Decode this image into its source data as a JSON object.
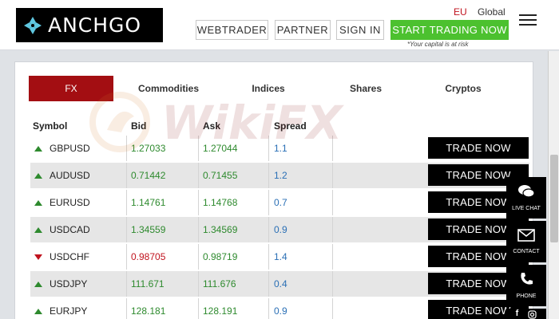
{
  "header": {
    "logo_text": "ANCHGO",
    "nav": [
      "WEBTRADER",
      "PARTNER",
      "SIGN IN"
    ],
    "cta": "START TRADING NOW",
    "disclaimer": "*Your capital is at risk",
    "region": "EU",
    "language": "Global"
  },
  "tabs": [
    "FX",
    "Commodities",
    "Indices",
    "Shares",
    "Cryptos"
  ],
  "active_tab": "FX",
  "columns": {
    "symbol": "Symbol",
    "bid": "Bid",
    "ask": "Ask",
    "spread": "Spread"
  },
  "trade_label": "TRADE NOW",
  "rows": [
    {
      "symbol": "GBPUSD",
      "bid": "1.27033",
      "ask": "1.27044",
      "spread": "1.1",
      "direction": "up"
    },
    {
      "symbol": "AUDUSD",
      "bid": "0.71442",
      "ask": "0.71455",
      "spread": "1.2",
      "direction": "up"
    },
    {
      "symbol": "EURUSD",
      "bid": "1.14761",
      "ask": "1.14768",
      "spread": "0.7",
      "direction": "up"
    },
    {
      "symbol": "USDCAD",
      "bid": "1.34559",
      "ask": "1.34569",
      "spread": "0.9",
      "direction": "up"
    },
    {
      "symbol": "USDCHF",
      "bid": "0.98705",
      "ask": "0.98719",
      "spread": "1.4",
      "direction": "down"
    },
    {
      "symbol": "USDJPY",
      "bid": "111.671",
      "ask": "111.676",
      "spread": "0.4",
      "direction": "up"
    },
    {
      "symbol": "EURJPY",
      "bid": "128.181",
      "ask": "128.191",
      "spread": "0.9",
      "direction": "up"
    }
  ],
  "side_buttons": [
    {
      "label": "LIVE CHAT",
      "icon": "chat-icon"
    },
    {
      "label": "CONTACT",
      "icon": "envelope-icon"
    },
    {
      "label": "PHONE",
      "icon": "phone-icon"
    }
  ],
  "social_icons": [
    "facebook-icon",
    "instagram-icon"
  ],
  "watermark": "WikiFX",
  "colors": {
    "brand_red": "#a30e12",
    "cta_green": "#4cc12f",
    "up_green": "#2e8a2e",
    "down_red": "#c0131e",
    "spread_blue": "#2a6fb5"
  }
}
